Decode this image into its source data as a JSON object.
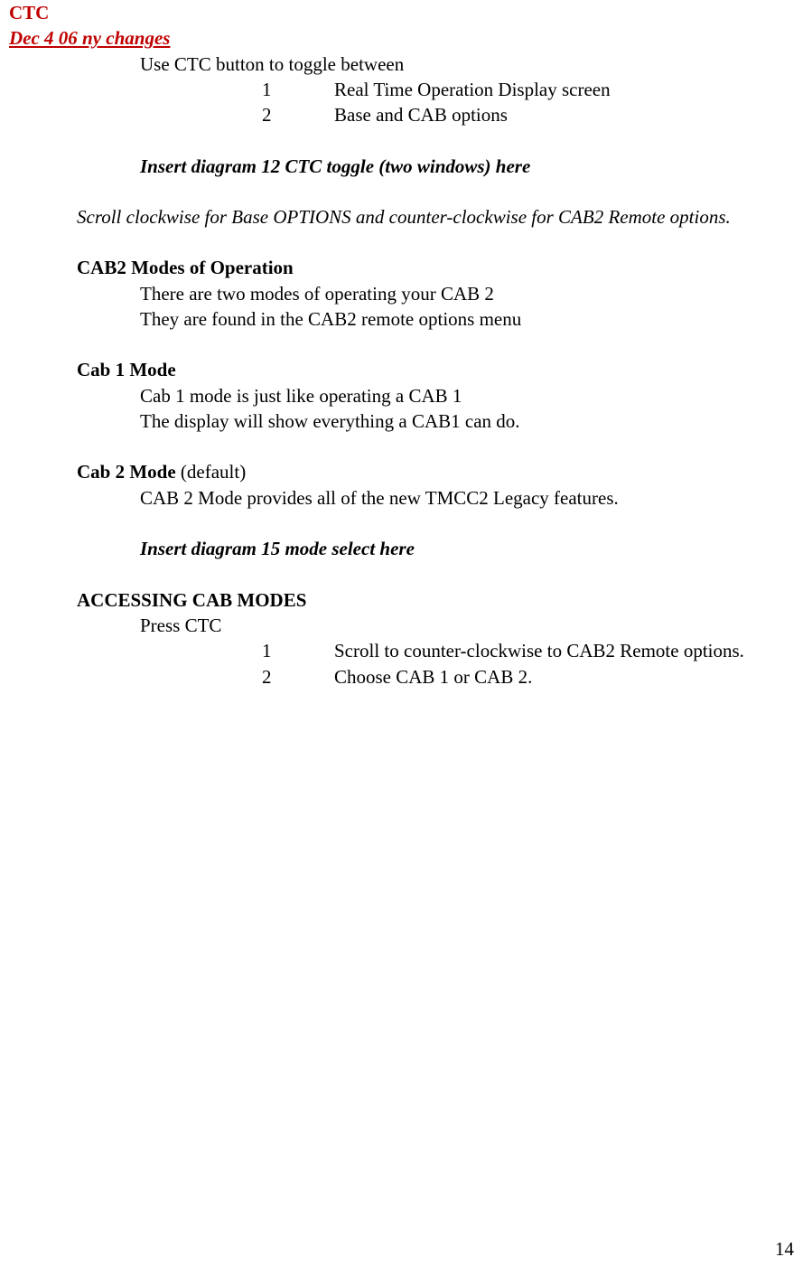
{
  "header": {
    "title": "CTC",
    "subtitle": "Dec 4 06 ny changes"
  },
  "section1": {
    "intro": "Use CTC button to toggle between",
    "items": [
      {
        "num": "1",
        "text": "Real Time Operation Display screen"
      },
      {
        "num": "2",
        "text": "Base and CAB options"
      }
    ],
    "diagram_note": "Insert diagram 12 CTC toggle (two windows) here",
    "scroll_note": "Scroll clockwise for Base OPTIONS and counter-clockwise for CAB2 Remote options."
  },
  "section2": {
    "heading": "CAB2 Modes of Operation",
    "line1": "There are two modes of operating your CAB 2",
    "line2": "They are found in the CAB2 remote options menu"
  },
  "section3": {
    "heading": "Cab 1 Mode",
    "line1": "Cab 1 mode is just like operating a CAB 1",
    "line2": "The display will show everything a CAB1 can do."
  },
  "section4": {
    "heading_bold": "Cab 2 Mode",
    "heading_rest": " (default)",
    "line1": "CAB 2 Mode provides all of the new TMCC2 Legacy features.",
    "diagram_note": "Insert diagram 15 mode select here"
  },
  "section5": {
    "heading": "ACCESSING CAB MODES",
    "line1": "Press CTC",
    "items": [
      {
        "num": "1",
        "text": "Scroll to counter-clockwise to CAB2 Remote options."
      },
      {
        "num": "2",
        "text": "Choose CAB 1 or CAB 2."
      }
    ]
  },
  "page_number": "14"
}
